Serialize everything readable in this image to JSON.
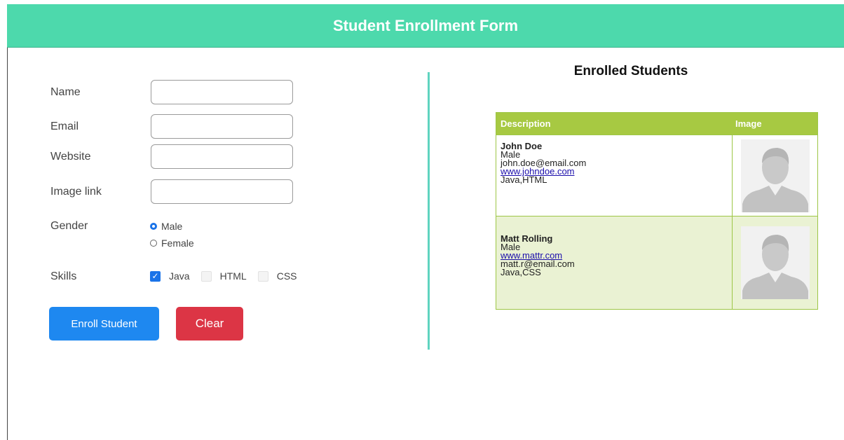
{
  "header": {
    "title": "Student Enrollment Form"
  },
  "form": {
    "fields": [
      {
        "label": "Name",
        "value": "",
        "placeholder": ""
      },
      {
        "label": "Email",
        "value": "",
        "placeholder": ""
      },
      {
        "label": "Website",
        "value": "",
        "placeholder": ""
      },
      {
        "label": "Image link",
        "value": "",
        "placeholder": ""
      }
    ],
    "gender": {
      "label": "Gender",
      "options": [
        "Male",
        "Female"
      ],
      "selected": "Male"
    },
    "skills": {
      "label": "Skills",
      "options": [
        {
          "label": "Java",
          "checked": true
        },
        {
          "label": "HTML",
          "checked": false
        },
        {
          "label": "CSS",
          "checked": false
        }
      ]
    },
    "enroll_label": "Enroll Student",
    "clear_label": "Clear"
  },
  "enrolled": {
    "title": "Enrolled Students",
    "columns": [
      "Description",
      "Image"
    ],
    "students": [
      {
        "name": "John Doe",
        "gender": "Male",
        "line3": "john.doe@email.com",
        "line4": "www.johndoe.com",
        "skills": "Java,HTML",
        "image": "avatar-placeholder"
      },
      {
        "name": "Matt Rolling",
        "gender": "Male",
        "line3": "www.mattr.com",
        "line4": "matt.r@email.com",
        "skills": "Java,CSS",
        "image": "avatar-placeholder"
      }
    ]
  },
  "colors": {
    "header": "#4dd9ac",
    "table_header": "#a7c942",
    "enroll_button": "#1e88f0",
    "clear_button": "#dc3545",
    "divider": "#5fd4c0"
  }
}
